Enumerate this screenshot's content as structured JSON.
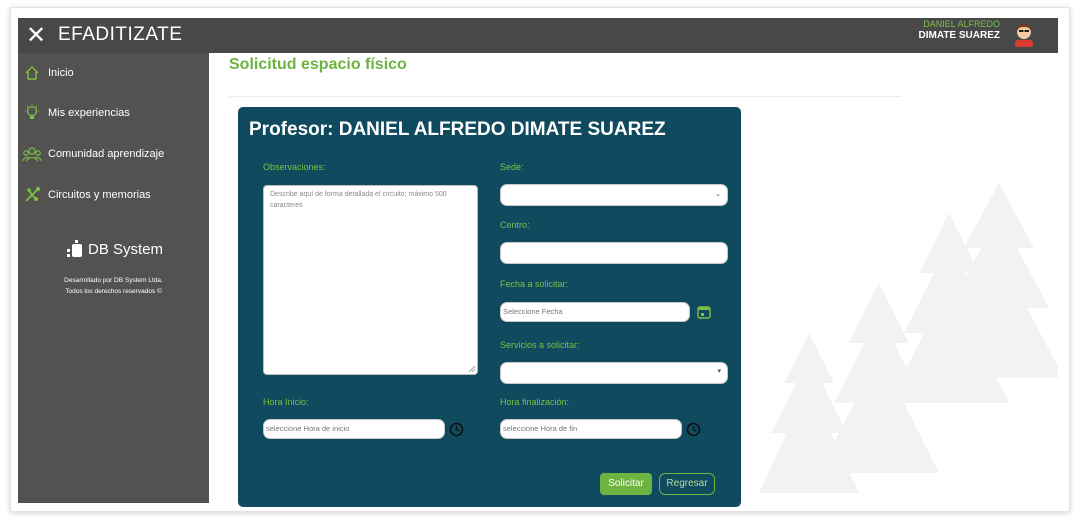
{
  "app": {
    "title": "EFADITIZATE"
  },
  "user": {
    "first_line": "DANIEL ALFREDO",
    "last_line": "DIMATE SUAREZ"
  },
  "sidebar": {
    "items": [
      {
        "label": "Inicio",
        "icon": "home-icon"
      },
      {
        "label": "Mis experiencias",
        "icon": "lightbulb-icon"
      },
      {
        "label": "Comunidad aprendizaje",
        "icon": "community-icon"
      },
      {
        "label": "Circuitos y memorias",
        "icon": "circuit-icon"
      }
    ],
    "brand": "DB System",
    "credits_line1": "Desarrollado por DB System Ltda.",
    "credits_line2": "Todos los derechos reservados ©"
  },
  "page": {
    "title": "Solicitud espacio físico"
  },
  "form": {
    "heading": "Profesor: DANIEL ALFREDO DIMATE SUAREZ",
    "observaciones_label": "Observaciones:",
    "observaciones_placeholder": "Describe aquí de forma detallada el circuito; máximo 500 caracteres",
    "sede_label": "Sede:",
    "centro_label": "Centro:",
    "fecha_label": "Fecha a solicitar:",
    "fecha_placeholder": "Seleccione Fecha",
    "servicios_label": "Servicios a solicitar:",
    "hora_inicio_label": "Hora Inicio:",
    "hora_inicio_placeholder": "seleccione Hora de inicio",
    "hora_fin_label": "Hora finalización:",
    "hora_fin_placeholder": "seleccione Hora de fin",
    "submit_label": "Solicitar",
    "back_label": "Regresar"
  },
  "colors": {
    "accent_green": "#6cb33f",
    "card_blue": "#0f4a5f",
    "topbar": "#484848",
    "sidebar": "#545151"
  }
}
